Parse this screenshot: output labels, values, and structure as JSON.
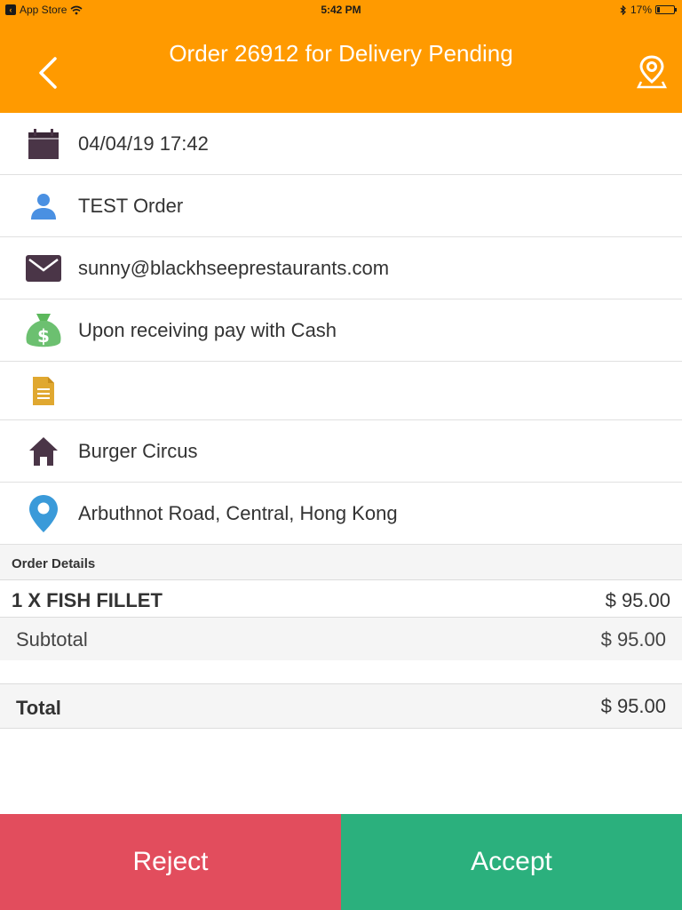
{
  "status_bar": {
    "carrier": "App Store",
    "time": "5:42 PM",
    "battery": "17%",
    "battery_level": 0.17
  },
  "header": {
    "title": "Order 26912 for Delivery Pending",
    "back_icon": "chevron-left-icon",
    "map_icon": "map-pin-icon"
  },
  "details": [
    {
      "icon": "calendar-icon",
      "text": "04/04/19 17:42"
    },
    {
      "icon": "person-icon",
      "text": "TEST Order"
    },
    {
      "icon": "envelope-icon",
      "text": "sunny@blackhseeprestaurants.com"
    },
    {
      "icon": "money-bag-icon",
      "text": "Upon receiving pay with Cash"
    },
    {
      "icon": "note-icon",
      "text": ""
    },
    {
      "icon": "home-icon",
      "text": "Burger Circus"
    },
    {
      "icon": "location-pin-icon",
      "text": "Arbuthnot Road, Central, Hong Kong"
    }
  ],
  "order": {
    "section_title": "Order Details",
    "items": [
      {
        "name": "1 X FISH FILLET",
        "price": "$ 95.00"
      }
    ],
    "subtotal_label": "Subtotal",
    "subtotal_value": "$ 95.00",
    "total_label": "Total",
    "total_value": "$ 95.00"
  },
  "actions": {
    "reject_label": "Reject",
    "accept_label": "Accept"
  },
  "colors": {
    "header": "#ff9a00",
    "reject": "#e24d5d",
    "accept": "#2bb07d"
  }
}
